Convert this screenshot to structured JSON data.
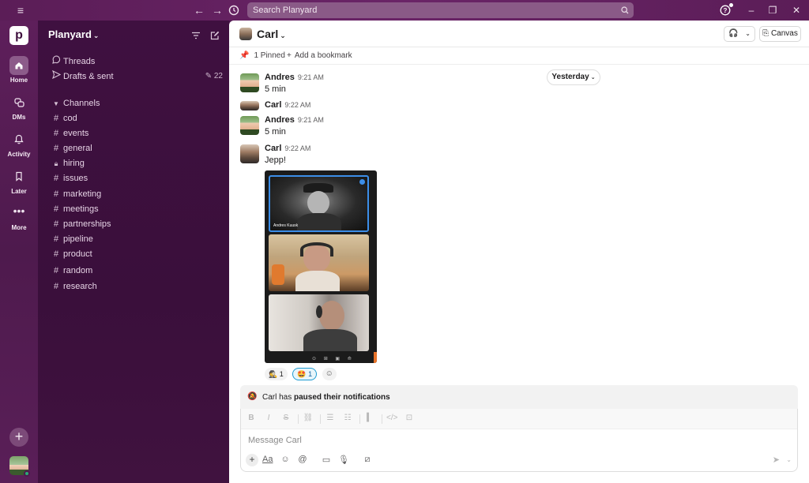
{
  "topbar": {
    "search_placeholder": "Search Planyard"
  },
  "rail": {
    "workspace_logo": "p",
    "items": [
      {
        "label": "Home",
        "icon": "home-icon"
      },
      {
        "label": "DMs",
        "icon": "dms-icon"
      },
      {
        "label": "Activity",
        "icon": "bell-icon"
      },
      {
        "label": "Later",
        "icon": "bookmark-icon"
      },
      {
        "label": "More",
        "icon": "more-icon"
      }
    ]
  },
  "sidebar": {
    "workspace_name": "Planyard",
    "threads_label": "Threads",
    "drafts_label": "Drafts & sent",
    "drafts_count": "22",
    "channels_header": "Channels",
    "channels": [
      {
        "name": "cod",
        "icon": "hash-icon"
      },
      {
        "name": "events",
        "icon": "hash-icon"
      },
      {
        "name": "general",
        "icon": "hash-icon"
      },
      {
        "name": "hiring",
        "icon": "lock-icon"
      },
      {
        "name": "issues",
        "icon": "hash-icon"
      },
      {
        "name": "marketing",
        "icon": "hash-icon"
      },
      {
        "name": "meetings",
        "icon": "hash-icon"
      },
      {
        "name": "partnerships",
        "icon": "hash-icon"
      },
      {
        "name": "pipeline",
        "icon": "hash-icon"
      },
      {
        "name": "product",
        "icon": "hash-icon"
      },
      {
        "name": "random",
        "icon": "hash-icon"
      },
      {
        "name": "research",
        "icon": "hash-icon"
      }
    ]
  },
  "channel": {
    "name": "Carl",
    "canvas_label": "Canvas",
    "pinned_label": "1 Pinned",
    "bookmark_label": "Add a bookmark",
    "date_divider": "Yesterday"
  },
  "messages": [
    {
      "author": "Andres",
      "time": "9:21 AM",
      "text": "5 min"
    },
    {
      "author": "Carl",
      "time": "9:22 AM",
      "text": ""
    },
    {
      "author": "Andres",
      "time": "9:21 AM",
      "text": "5 min"
    },
    {
      "author": "Carl",
      "time": "9:22 AM",
      "text": "Jepp!"
    }
  ],
  "attachment": {
    "tile1_name": "Andres Kuusk"
  },
  "reactions": [
    {
      "emoji": "🕵",
      "count": "1"
    },
    {
      "emoji": "🤩",
      "count": "1"
    }
  ],
  "notice": {
    "prefix": "Carl has ",
    "bold": "paused their notifications"
  },
  "composer": {
    "placeholder": "Message Carl",
    "format_label": "Aa"
  },
  "colors": {
    "aubergine": "#4a154b",
    "sidebar": "#3f1040",
    "link_blue": "#1264a3",
    "online_green": "#2bac76"
  }
}
